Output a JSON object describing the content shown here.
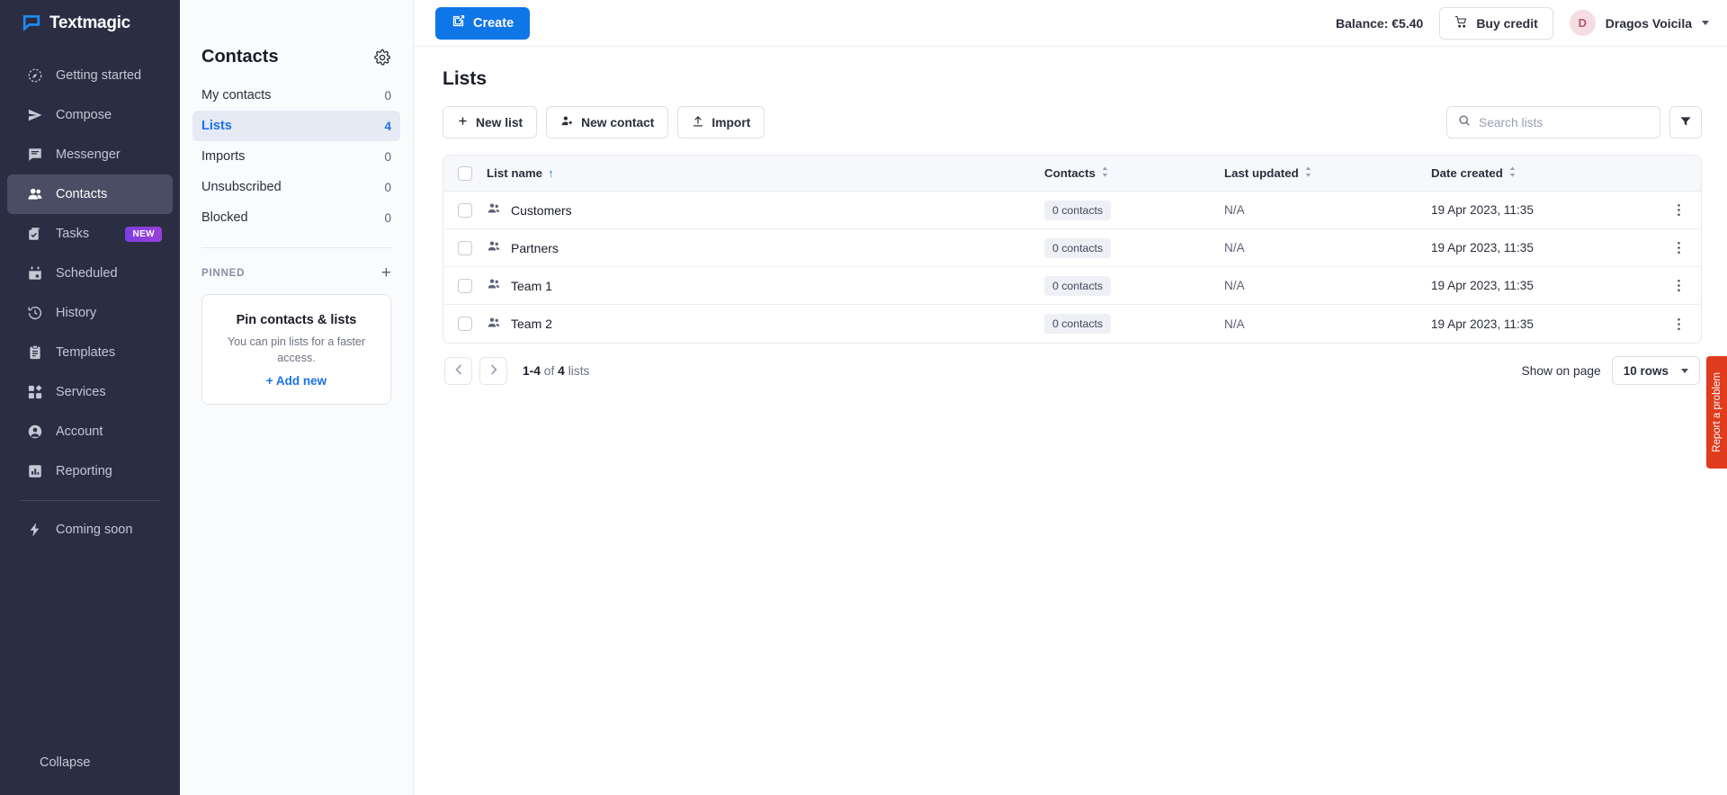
{
  "brand": {
    "name": "Textmagic"
  },
  "nav": {
    "items": [
      {
        "label": "Getting started",
        "icon": "compass-icon",
        "active": false
      },
      {
        "label": "Compose",
        "icon": "paper-plane-icon",
        "active": false
      },
      {
        "label": "Messenger",
        "icon": "chat-icon",
        "active": false
      },
      {
        "label": "Contacts",
        "icon": "people-icon",
        "active": true
      },
      {
        "label": "Tasks",
        "icon": "checkbox-tasks-icon",
        "active": false,
        "badge": "NEW"
      },
      {
        "label": "Scheduled",
        "icon": "calendar-icon",
        "active": false
      },
      {
        "label": "History",
        "icon": "clock-history-icon",
        "active": false
      },
      {
        "label": "Templates",
        "icon": "clipboard-icon",
        "active": false
      },
      {
        "label": "Services",
        "icon": "grid-services-icon",
        "active": false
      },
      {
        "label": "Account",
        "icon": "user-circle-icon",
        "active": false
      },
      {
        "label": "Reporting",
        "icon": "bar-chart-icon",
        "active": false
      }
    ],
    "coming_soon": {
      "label": "Coming soon",
      "icon": "lightning-icon"
    },
    "collapse": {
      "label": "Collapse",
      "icon": "collapse-arrow-icon"
    }
  },
  "subnav": {
    "title": "Contacts",
    "settings_icon": "gear-icon",
    "items": [
      {
        "label": "My contacts",
        "count": "0",
        "active": false
      },
      {
        "label": "Lists",
        "count": "4",
        "active": true
      },
      {
        "label": "Imports",
        "count": "0",
        "active": false
      },
      {
        "label": "Unsubscribed",
        "count": "0",
        "active": false
      },
      {
        "label": "Blocked",
        "count": "0",
        "active": false
      }
    ],
    "pinned": {
      "section_label": "PINNED",
      "add_icon": "plus-icon",
      "card_title": "Pin contacts & lists",
      "card_text": "You can pin lists for a faster access.",
      "card_link": "+ Add new"
    }
  },
  "topbar": {
    "create_label": "Create",
    "create_icon": "compose-pencil-icon",
    "balance": "Balance: €5.40",
    "buy_credit_label": "Buy credit",
    "buy_credit_icon": "cart-icon",
    "user_initial": "D",
    "user_name": "Dragos Voicila",
    "user_caret_icon": "chevron-down-icon"
  },
  "main": {
    "page_title": "Lists",
    "toolbar": [
      {
        "label": "New list",
        "icon": "plus-icon"
      },
      {
        "label": "New contact",
        "icon": "user-plus-icon"
      },
      {
        "label": "Import",
        "icon": "upload-icon"
      }
    ],
    "search": {
      "placeholder": "Search lists",
      "value": "",
      "icon": "search-icon"
    },
    "filter_icon": "filter-icon",
    "table": {
      "columns": [
        {
          "label": "List name",
          "sorted": "asc"
        },
        {
          "label": "Contacts",
          "sorted": "none"
        },
        {
          "label": "Last updated",
          "sorted": "none"
        },
        {
          "label": "Date created",
          "sorted": "none"
        }
      ],
      "rows": [
        {
          "name": "Customers",
          "contacts": "0 contacts",
          "last_updated": "N/A",
          "date_created": "19 Apr 2023, 11:35"
        },
        {
          "name": "Partners",
          "contacts": "0 contacts",
          "last_updated": "N/A",
          "date_created": "19 Apr 2023, 11:35"
        },
        {
          "name": "Team 1",
          "contacts": "0 contacts",
          "last_updated": "N/A",
          "date_created": "19 Apr 2023, 11:35"
        },
        {
          "name": "Team 2",
          "contacts": "0 contacts",
          "last_updated": "N/A",
          "date_created": "19 Apr 2023, 11:35"
        }
      ]
    },
    "pagination": {
      "prev_icon": "chevron-left-icon",
      "next_icon": "chevron-right-icon",
      "range": "1-4",
      "of": "of",
      "total": "4",
      "unit": "lists",
      "show_label": "Show on page",
      "rows_value": "10 rows"
    }
  },
  "report_tab": {
    "label": "Report a problem"
  },
  "colors": {
    "sidebar_bg": "#2b2d42",
    "accent_blue": "#1a73e8",
    "create_blue": "#0f76e8",
    "report_red": "#e03c1f",
    "badge_purple": "#7b3fe4"
  }
}
